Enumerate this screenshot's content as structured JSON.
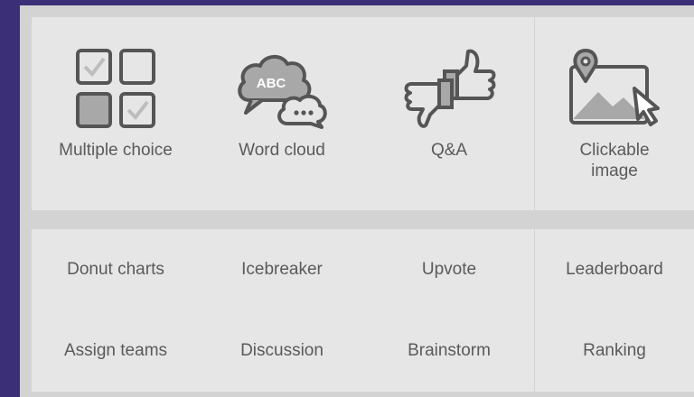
{
  "top_tiles": [
    {
      "label": "Multiple choice",
      "icon": "multiple-choice-checkbox-icon"
    },
    {
      "label": "Word cloud",
      "icon": "word-cloud-speech-bubbles-icon",
      "icon_text": "ABC"
    },
    {
      "label": "Q&A",
      "icon": "thumbs-up-down-icon"
    },
    {
      "label": "Clickable\nimage",
      "icon": "clickable-image-icon"
    }
  ],
  "bottom_items": [
    {
      "label": "Donut charts"
    },
    {
      "label": "Icebreaker"
    },
    {
      "label": "Upvote"
    },
    {
      "label": "Leaderboard"
    },
    {
      "label": "Assign teams"
    },
    {
      "label": "Discussion"
    },
    {
      "label": "Brainstorm"
    },
    {
      "label": "Ranking"
    }
  ],
  "colors": {
    "background": "#3b3078",
    "panel": "#d3d3d3",
    "tile": "#e6e6e6",
    "icon_stroke": "#555555",
    "text": "#5a5a5a"
  }
}
